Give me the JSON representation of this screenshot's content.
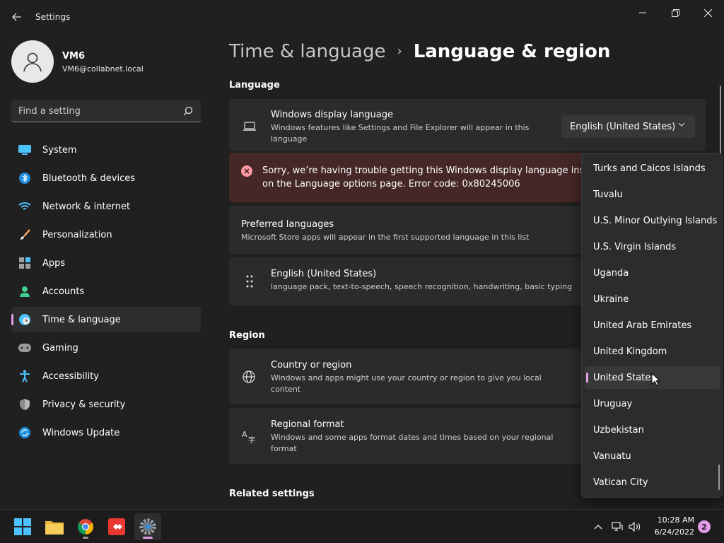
{
  "window": {
    "title": "Settings",
    "minimize_label": "–",
    "maximize_label": "❐",
    "close_label": "✕"
  },
  "profile": {
    "name": "VM6",
    "email": "VM6@collabnet.local"
  },
  "search": {
    "placeholder": "Find a setting"
  },
  "sidebar": {
    "items": [
      {
        "label": "System",
        "icon": "monitor-icon"
      },
      {
        "label": "Bluetooth & devices",
        "icon": "bluetooth-icon"
      },
      {
        "label": "Network & internet",
        "icon": "wifi-icon"
      },
      {
        "label": "Personalization",
        "icon": "brush-icon"
      },
      {
        "label": "Apps",
        "icon": "apps-icon"
      },
      {
        "label": "Accounts",
        "icon": "person-icon"
      },
      {
        "label": "Time & language",
        "icon": "clock-globe-icon",
        "active": true
      },
      {
        "label": "Gaming",
        "icon": "gamepad-icon"
      },
      {
        "label": "Accessibility",
        "icon": "accessibility-icon"
      },
      {
        "label": "Privacy & security",
        "icon": "shield-icon"
      },
      {
        "label": "Windows Update",
        "icon": "update-icon"
      }
    ]
  },
  "breadcrumb": {
    "parent": "Time & language",
    "separator": "›",
    "current": "Language & region"
  },
  "language": {
    "heading": "Language",
    "display": {
      "title": "Windows display language",
      "desc": "Windows features like Settings and File Explorer will appear in this language",
      "value": "English (United States)"
    },
    "error": {
      "line1": "Sorry, we’re having trouble getting this Windows display language installed",
      "line2": "on the Language options page. Error code: 0x80245006"
    },
    "preferred": {
      "title": "Preferred languages",
      "desc": "Microsoft Store apps will appear in the first supported language in this list"
    },
    "entry": {
      "title": "English (United States)",
      "desc": "language pack, text-to-speech, speech recognition, handwriting, basic typing"
    }
  },
  "region": {
    "heading": "Region",
    "country": {
      "title": "Country or region",
      "desc": "Windows and apps might use your country or region to give you local content"
    },
    "format": {
      "title": "Regional format",
      "desc": "Windows and some apps format dates and times based on your regional format"
    }
  },
  "related": {
    "heading": "Related settings"
  },
  "country_dropdown": {
    "options": [
      "Turks and Caicos Islands",
      "Tuvalu",
      "U.S. Minor Outlying Islands",
      "U.S. Virgin Islands",
      "Uganda",
      "Ukraine",
      "United Arab Emirates",
      "United Kingdom",
      "United States",
      "Uruguay",
      "Uzbekistan",
      "Vanuatu",
      "Vatican City"
    ],
    "selected": "United States"
  },
  "taskbar": {
    "apps": [
      "start-icon",
      "file-explorer-icon",
      "chrome-icon",
      "anydesk-icon",
      "settings-icon"
    ],
    "time": "10:28 AM",
    "date": "6/24/2022",
    "notification_count": "2"
  },
  "colors": {
    "accent": "#e39ce8",
    "error_bg": "#442726",
    "error_icon": "#ff99a4"
  }
}
